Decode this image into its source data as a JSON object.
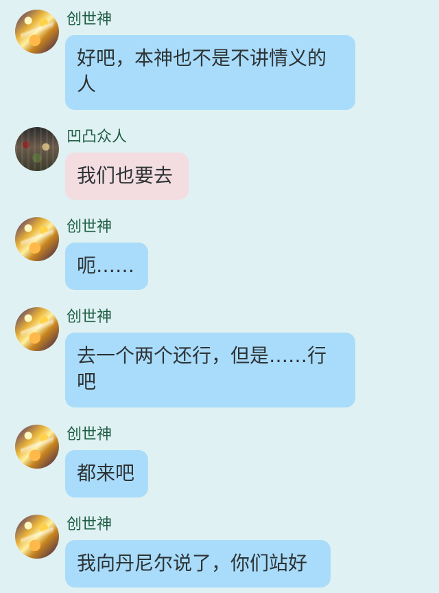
{
  "messages": [
    {
      "sender": "创世神",
      "text": "好吧，本神也不是不讲情义的\n人",
      "avatar": "avatar-golden-angel",
      "bubble_color": "#a9dcfa"
    },
    {
      "sender": "凹凸众人",
      "text": "我们也要去",
      "avatar": "avatar-crowd",
      "bubble_color": "#f3dde1"
    },
    {
      "sender": "创世神",
      "text": "呃……",
      "avatar": "avatar-golden-angel",
      "bubble_color": "#a9dcfa"
    },
    {
      "sender": "创世神",
      "text": "去一个两个还行，但是……行\n吧",
      "avatar": "avatar-golden-angel",
      "bubble_color": "#a9dcfa"
    },
    {
      "sender": "创世神",
      "text": "都来吧",
      "avatar": "avatar-golden-angel",
      "bubble_color": "#a9dcfa"
    },
    {
      "sender": "创世神",
      "text": "我向丹尼尔说了，你们站好",
      "avatar": "avatar-golden-angel",
      "bubble_color": "#a9dcfa"
    }
  ],
  "colors": {
    "background": "#dff1f2",
    "sender_name": "#1f5d44",
    "bubble_text": "#2d3336"
  }
}
